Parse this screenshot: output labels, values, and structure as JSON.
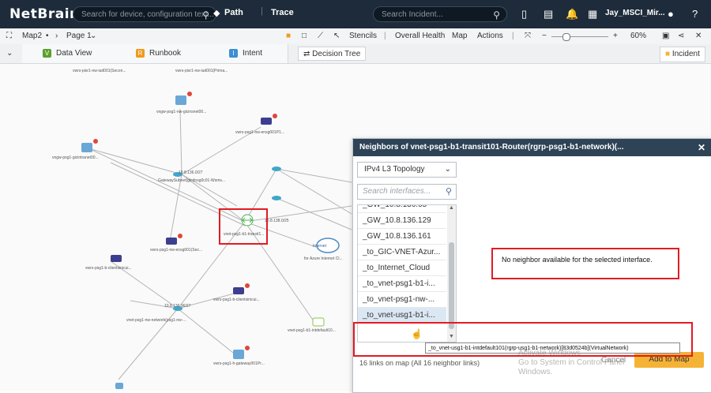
{
  "topbar": {
    "logo": "NetBrain",
    "search_placeholder": "Search for device, configuration text...",
    "path_label": "Path",
    "trace_label": "Trace",
    "incident_search_placeholder": "Search Incident...",
    "user_name": "Jay_MSCI_Mir..."
  },
  "toolbar": {
    "map_name": "Map2",
    "page_name": "Page 1",
    "stencils": "Stencils",
    "overall_health": "Overall Health",
    "map": "Map",
    "actions": "Actions",
    "zoom": "60%"
  },
  "tabs": {
    "data_view": "Data View",
    "runbook": "Runbook",
    "intent": "Intent",
    "decision_tree": "Decision Tree",
    "incident": "Incident"
  },
  "colors": {
    "data_view": "#5aa02c",
    "runbook": "#f09a1e",
    "intent": "#3d8fd1",
    "highlight": "#e21b23",
    "panel_header": "#2e4356",
    "add_button": "#f5b335"
  },
  "map_labels": {
    "top_a": "vwrs-pisr1-nw-iud001(Secon...",
    "top_b": "vwrs-pisr1-nw-iud001(Prima...",
    "n1": "vngw-psg1-nw-gicinsnet00...",
    "n2": "vngw-psg1-gicintranet00...",
    "n3": "vwrs-psg1-nw-ensg001P1...",
    "n4": "GatewaySubnet(gicdnsg0c01-Wsms...",
    "n5": "vnet-psg1-b1-transit1...",
    "n6": "vwrs-psg1-nw-ensg001(Sec...",
    "n7": "vwrs-psg1-b-clientsinicui...",
    "n8": "vwrs-psg1-b-clientsinicui...",
    "n9": "for Azure Internet Cl...",
    "n10": "vnet-psg1-nw-network(psg1-nw-...",
    "n11": "vnet-psg1-b1-intdefault10...",
    "n12": "vwrs-psg1-h-gateway001Pr...",
    "internet": "Internet",
    "ip1": "10.8.136.0/27",
    "ip2": "10.8.138.0/25",
    "ip3": "10.8.136.96/27"
  },
  "neighbors_panel": {
    "title": "Neighbors of vnet-psg1-b1-transit101-Router(rgrp-psg1-b1-network)(...",
    "topology": "IPv4 L3 Topology",
    "search_placeholder": "Search interfaces...",
    "interfaces": [
      "_GW_10.8.136.65",
      "_GW_10.8.136.129",
      "_GW_10.8.136.161",
      "_to_GIC-VNET-Azur...",
      "_to_Internet_Cloud",
      "_to_vnet-psg1-b1-i...",
      "_to_vnet-psg1-nw-...",
      "_to_vnet-usg1-b1-i..."
    ],
    "empty_message": "No neighbor available for the selected interface.",
    "tooltip": "_to_vnet-usg1-b1-intdefault101(rgrp-usg1-b1-network)[83d0524b](VirtualNetwork)",
    "footer": "16 links on map (All 16 neighbor links)",
    "cancel": "Cancel",
    "add_to_map": "Add to Map"
  },
  "watermark": {
    "line1": "Activate Windows",
    "line2": "Go to System in Control Panel",
    "line3": "Windows."
  }
}
